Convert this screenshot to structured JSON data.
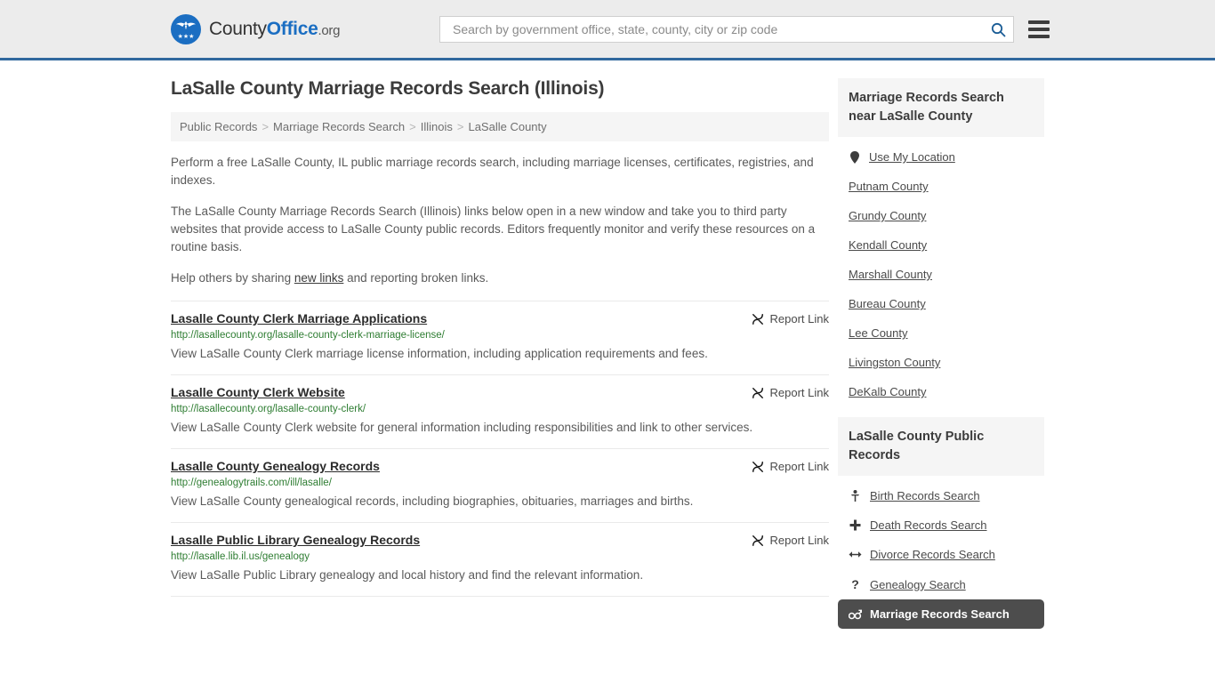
{
  "header": {
    "logo": {
      "part1": "County",
      "part2": "Office",
      "tld": ".org",
      "icon": "eagle-seal-icon"
    },
    "search": {
      "placeholder": "Search by government office, state, county, city or zip code",
      "value": ""
    },
    "search_icon": "search-icon",
    "menu_icon": "hamburger-menu-icon"
  },
  "main": {
    "title": "LaSalle County Marriage Records Search (Illinois)",
    "breadcrumb": [
      "Public Records",
      "Marriage Records Search",
      "Illinois",
      "LaSalle County"
    ],
    "breadcrumb_separator": ">",
    "intro": {
      "p1": "Perform a free LaSalle County, IL public marriage records search, including marriage licenses, certificates, registries, and indexes.",
      "p2": "The LaSalle County Marriage Records Search (Illinois) links below open in a new window and take you to third party websites that provide access to LaSalle County public records. Editors frequently monitor and verify these resources on a routine basis.",
      "p3_before": "Help others by sharing ",
      "p3_link": "new links",
      "p3_after": " and reporting broken links."
    },
    "report_link_label": "Report Link",
    "report_link_icon": "broken-link-icon",
    "results": [
      {
        "title": "Lasalle County Clerk Marriage Applications",
        "url": "http://lasallecounty.org/lasalle-county-clerk-marriage-license/",
        "description": "View LaSalle County Clerk marriage license information, including application requirements and fees."
      },
      {
        "title": "Lasalle County Clerk Website",
        "url": "http://lasallecounty.org/lasalle-county-clerk/",
        "description": "View LaSalle County Clerk website for general information including responsibilities and link to other services."
      },
      {
        "title": "Lasalle County Genealogy Records",
        "url": "http://genealogytrails.com/ill/lasalle/",
        "description": "View LaSalle County genealogical records, including biographies, obituaries, marriages and births."
      },
      {
        "title": "Lasalle Public Library Genealogy Records",
        "url": "http://lasalle.lib.il.us/genealogy",
        "description": "View LaSalle Public Library genealogy and local history and find the relevant information."
      }
    ]
  },
  "sidebar": {
    "nearby": {
      "heading": "Marriage Records Search near LaSalle County",
      "items": [
        {
          "label": "Use My Location",
          "icon": "map-pin-icon"
        },
        {
          "label": "Putnam County",
          "icon": ""
        },
        {
          "label": "Grundy County",
          "icon": ""
        },
        {
          "label": "Kendall County",
          "icon": ""
        },
        {
          "label": "Marshall County",
          "icon": ""
        },
        {
          "label": "Bureau County",
          "icon": ""
        },
        {
          "label": "Lee County",
          "icon": ""
        },
        {
          "label": "Livingston County",
          "icon": ""
        },
        {
          "label": "DeKalb County",
          "icon": ""
        }
      ]
    },
    "public_records": {
      "heading": "LaSalle County Public Records",
      "items": [
        {
          "label": "Birth Records Search",
          "icon": "baby-icon",
          "glyph": "Ɣ",
          "active": false
        },
        {
          "label": "Death Records Search",
          "icon": "cross-icon",
          "glyph": "✚",
          "active": false
        },
        {
          "label": "Divorce Records Search",
          "icon": "double-arrow-icon",
          "glyph": "↔",
          "active": false
        },
        {
          "label": "Genealogy Search",
          "icon": "question-mark-icon",
          "glyph": "?",
          "active": false
        },
        {
          "label": "Marriage Records Search",
          "icon": "male-female-icon",
          "glyph": "⚤",
          "active": true
        }
      ]
    }
  },
  "colors": {
    "brand_blue": "#1b6ec2",
    "header_bg": "#ececec",
    "header_border": "#31689e",
    "panel_bg": "#f5f5f5",
    "url_green": "#2e7d32",
    "active_bg": "#4d4d4d"
  }
}
